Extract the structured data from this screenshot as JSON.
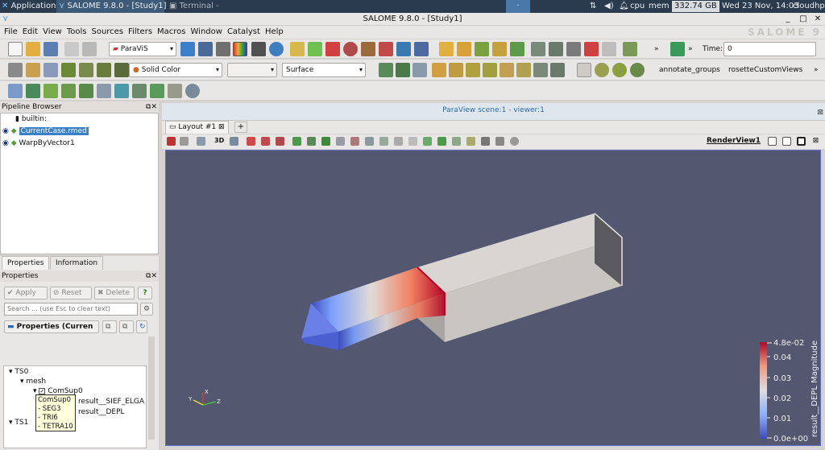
{
  "taskbar": {
    "applications_label": "Applications",
    "salome_task": "SALOME  9.8.0 - [Study1]",
    "terminal_task": "Terminal -",
    "cpu_label": "cpu",
    "mem_label": "mem",
    "mem_value": "332.74 GB",
    "clock": "Wed 23 Nov, 14:03",
    "user": "cloudhpc"
  },
  "window": {
    "title": "SALOME  9.8.0 - [Study1]",
    "logo": "SALOME 9"
  },
  "menubar": {
    "items": [
      "File",
      "Edit",
      "View",
      "Tools",
      "Sources",
      "Filters",
      "Macros",
      "Window",
      "Catalyst",
      "Help"
    ]
  },
  "toolbar1": {
    "module_combo": "ParaViS",
    "time_label": "Time:",
    "time_value": "0",
    "more_label": "»"
  },
  "toolbar2": {
    "color_combo": "Solid Color",
    "representation_combo": "Surface",
    "annotate_groups": "annotate_groups",
    "rosette_views": "rosetteCustomViews",
    "more_label": "»"
  },
  "pipeline": {
    "title": "Pipeline Browser",
    "items": [
      "builtin:",
      "CurrentCase.rmed",
      "WarpByVector1"
    ]
  },
  "properties": {
    "tabs": [
      "Properties",
      "Information"
    ],
    "section_title": "Properties",
    "apply_label": "Apply",
    "reset_label": "Reset",
    "delete_label": "Delete",
    "help_label": "?",
    "search_placeholder": "Search ... (use Esc to clear text)",
    "group_label": "Properties (Curren",
    "tree": {
      "ts0": "TS0",
      "mesh": "mesh",
      "comsup": "ComSup0",
      "field1": "result__SIEF_ELGA",
      "field2": "result__DEPL",
      "ts1": "TS1"
    },
    "tooltip_lines": [
      "ComSup0",
      "- SEG3",
      "- TRI6",
      "- TETRA10"
    ]
  },
  "viewer": {
    "header": "ParaView scene:1 - viewer:1",
    "layout_tab": "Layout #1",
    "add_tab": "+",
    "render_view_label": "RenderView1",
    "btn_3d": "3D"
  },
  "colorbar": {
    "title": "result__DEPL Magnitude",
    "ticks": [
      "4.8e-02",
      "0.04",
      "0.03",
      "0.02",
      "0.01",
      "0.0e+00"
    ]
  },
  "axes": {
    "x": "X",
    "y": "Y",
    "z": "Z"
  },
  "colors": {
    "background": "#535770",
    "taskbar": "#2a3b4d",
    "selection": "#3a80c8",
    "colormap_low": "#3b4cc0",
    "colormap_mid": "#dddddd",
    "colormap_high": "#b40426"
  }
}
